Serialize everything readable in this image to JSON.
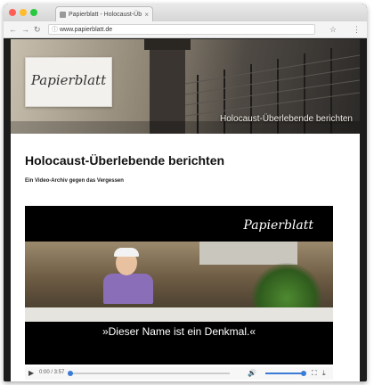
{
  "browser": {
    "tab_title": "Papierblatt - Holocaust-Üb",
    "tab_close": "×",
    "url": "www.papierblatt.de",
    "back": "←",
    "forward": "→",
    "reload": "↻",
    "lock": "ⓘ",
    "star": "☆",
    "menu": "⋮"
  },
  "banner": {
    "logo": "Papierblatt",
    "caption": "Holocaust-Überlebende berichten"
  },
  "article": {
    "headline": "Holocaust-Überlebende berichten",
    "subline": "Ein Video-Archiv gegen das Vergessen"
  },
  "video": {
    "logo": "Papierblatt",
    "subtitle": "»Dieser Name ist ein Denkmal.«",
    "time": "0:00 / 3:57",
    "progress": 0.0,
    "volume": 0.9
  },
  "colors": {
    "accent": "#3a7bd5",
    "close_light": "#ff5f57",
    "min_light": "#febc2e",
    "max_light": "#28c840"
  }
}
